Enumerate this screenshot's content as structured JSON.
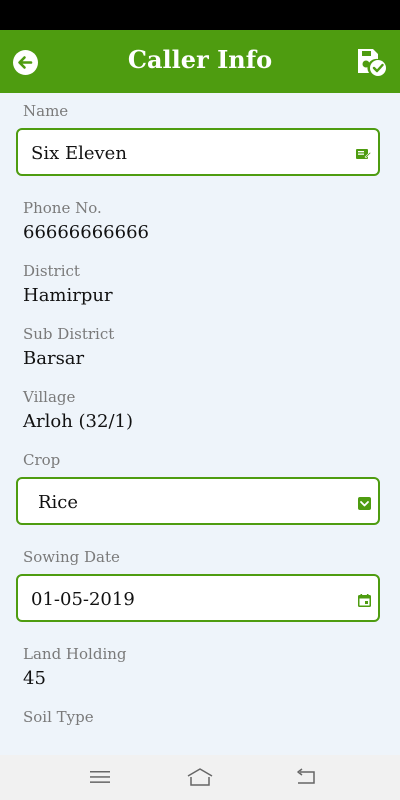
{
  "header": {
    "title": "Caller Info"
  },
  "fields": {
    "name_label": "Name",
    "name_value": "Six Eleven",
    "phone_label": "Phone No.",
    "phone_value": "66666666666",
    "district_label": "District",
    "district_value": "Hamirpur",
    "subdistrict_label": "Sub District",
    "subdistrict_value": "Barsar",
    "village_label": "Village",
    "village_value": "Arloh (32/1)",
    "crop_label": "Crop",
    "crop_value": "Rice",
    "sowing_label": "Sowing Date",
    "sowing_value": "01-05-2019",
    "land_label": "Land Holding",
    "land_value": "45",
    "soil_label": "Soil Type"
  },
  "icons": {
    "back": "back-arrow-icon",
    "save": "save-check-icon",
    "edit": "edit-note-icon",
    "dropdown": "dropdown-check-icon",
    "calendar": "calendar-icon",
    "nav_menu": "menu-icon",
    "nav_home": "home-icon",
    "nav_back": "back-icon"
  },
  "colors": {
    "accent": "#4e9c10",
    "background": "#eef4fa"
  }
}
